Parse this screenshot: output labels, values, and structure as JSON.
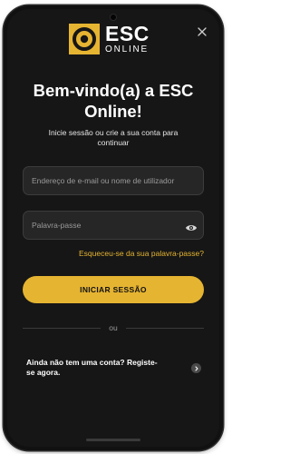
{
  "brand": {
    "name": "ESC",
    "tagline": "ONLINE",
    "accent_color": "#e5b431"
  },
  "header": {
    "close_icon": "close-icon"
  },
  "welcome": {
    "title": "Bem-vindo(a) a ESC Online!",
    "subtitle": "Inicie sessão ou crie a sua conta para continuar"
  },
  "form": {
    "email_placeholder": "Endereço de e-mail ou nome de utilizador",
    "email_value": "",
    "password_placeholder": "Palavra-passe",
    "password_value": "",
    "password_toggle_icon": "eye-icon",
    "forgot_password": "Esqueceu-se da sua palavra-passe?",
    "submit_label": "INICIAR SESSÃO"
  },
  "divider": {
    "label": "ou"
  },
  "register": {
    "text": "Ainda não tem uma conta? Registe-se agora.",
    "arrow_icon": "chevron-right-icon"
  }
}
